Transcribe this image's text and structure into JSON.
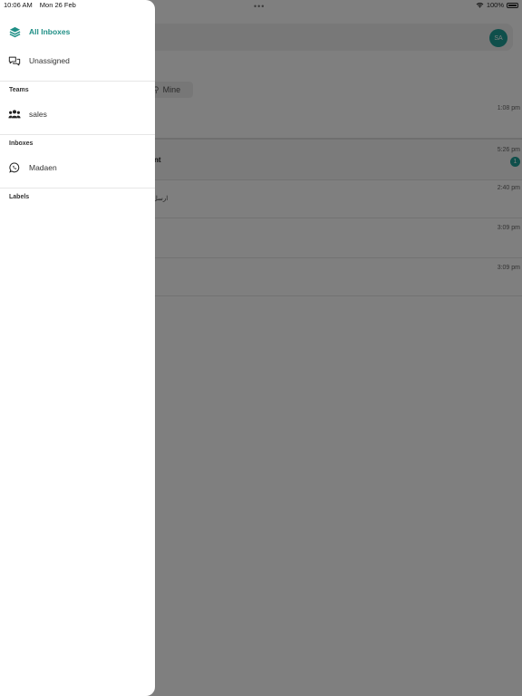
{
  "status_bar": {
    "time": "10:06 AM",
    "date": "Mon 26 Feb",
    "battery": "100%"
  },
  "drawer": {
    "items": [
      {
        "label": "All Inboxes",
        "icon": "layers-icon",
        "active": true
      },
      {
        "label": "Unassigned",
        "icon": "chat-bubbles-icon",
        "active": false
      }
    ],
    "teams_title": "Teams",
    "teams": [
      {
        "label": "sales",
        "icon": "team-icon"
      }
    ],
    "inboxes_title": "Inboxes",
    "inboxes": [
      {
        "label": "Madaen",
        "icon": "whatsapp-icon"
      }
    ],
    "labels_title": "Labels"
  },
  "background": {
    "avatar_initials": "SA",
    "filter_label": "Mine",
    "conversations": [
      {
        "time": "1:08 pm",
        "name": "",
        "preview": "",
        "unread": ""
      },
      {
        "time": "5:26 pm",
        "name": "nt",
        "preview": "",
        "unread": "1"
      },
      {
        "time": "2:40 pm",
        "name": "",
        "preview": "ارسل لم",
        "unread": ""
      },
      {
        "time": "3:09 pm",
        "name": "",
        "preview": "",
        "unread": ""
      },
      {
        "time": "3:09 pm",
        "name": "",
        "preview": "",
        "unread": ""
      }
    ]
  },
  "colors": {
    "accent": "#1f9e96",
    "active_text": "#1f8f86",
    "scrim": "rgba(0,0,0,0.5)"
  }
}
